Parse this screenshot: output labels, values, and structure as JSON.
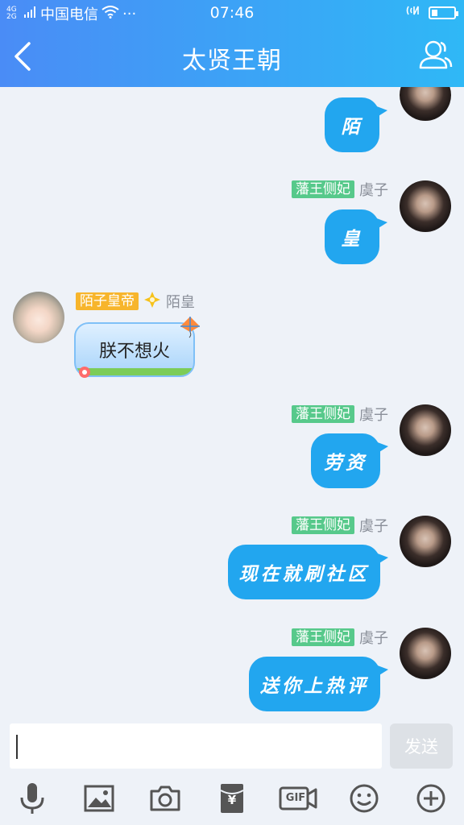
{
  "status_bar": {
    "network": "4G 2G",
    "carrier": "中国电信",
    "more": "···",
    "time": "07:46",
    "battery_level": 0.25
  },
  "header": {
    "title": "太贤王朝"
  },
  "messages": [
    {
      "side": "right",
      "text": "陌"
    },
    {
      "side": "right",
      "badge": "藩王侧妃",
      "nick": "虞子",
      "text": "皇"
    },
    {
      "side": "left",
      "badge": "陌子皇帝",
      "nick": "陌皇",
      "text": "朕不想火"
    },
    {
      "side": "right",
      "badge": "藩王侧妃",
      "nick": "虞子",
      "text": "劳资"
    },
    {
      "side": "right",
      "badge": "藩王侧妃",
      "nick": "虞子",
      "text": "现在就刷社区"
    },
    {
      "side": "right",
      "badge": "藩王侧妃",
      "nick": "虞子",
      "text": "送你上热评"
    }
  ],
  "input": {
    "send_label": "发送"
  },
  "toolbar": {
    "gif_label": "GIF",
    "red_packet_label": "¥"
  },
  "colors": {
    "header_start": "#4a8cf6",
    "header_end": "#2fb8f6",
    "bubble": "#22a6ef",
    "badge_green": "#57c98b",
    "badge_orange": "#f7b52c"
  }
}
